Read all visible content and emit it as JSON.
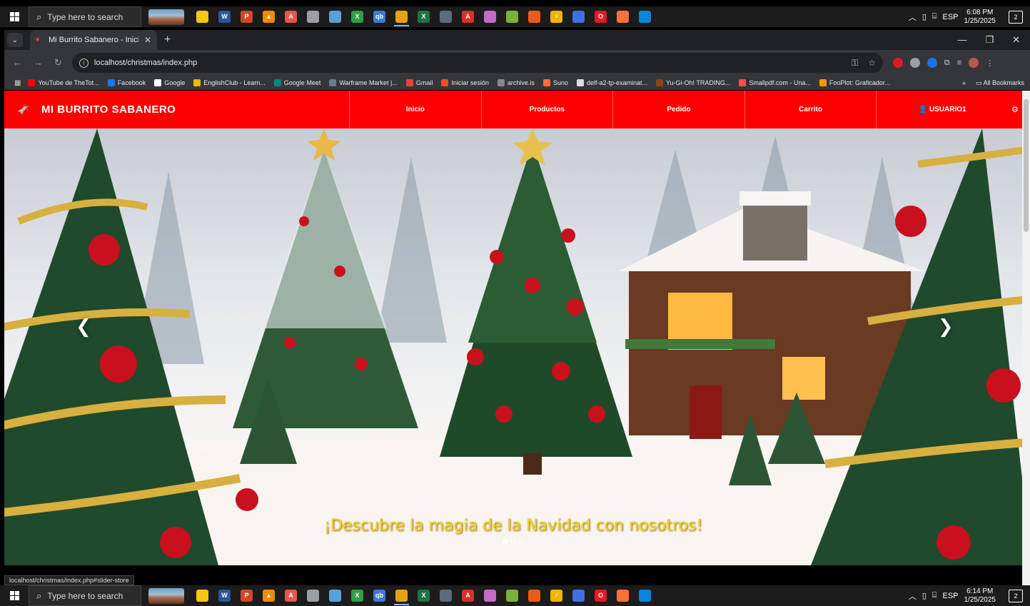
{
  "taskbar": {
    "search_placeholder": "Type here to search",
    "apps": [
      {
        "icon": "file-explorer-icon",
        "color": "#f5c518",
        "glyph": ""
      },
      {
        "icon": "word-icon",
        "color": "#2b579a",
        "glyph": "W"
      },
      {
        "icon": "powerpoint-icon",
        "color": "#d24726",
        "glyph": "P"
      },
      {
        "icon": "vlc-icon",
        "color": "#f08a00",
        "glyph": "▲"
      },
      {
        "icon": "pdf-reader-icon",
        "color": "#e2574c",
        "glyph": "A"
      },
      {
        "icon": "cloud-app-icon",
        "color": "#9aa0a6",
        "glyph": ""
      },
      {
        "icon": "feather-app-icon",
        "color": "#5aa0d8",
        "glyph": ""
      },
      {
        "icon": "xbox-icon",
        "color": "#2f9e44",
        "glyph": "X"
      },
      {
        "icon": "qbittorrent-icon",
        "color": "#3c7bd8",
        "glyph": "qb"
      },
      {
        "icon": "chrome-icon",
        "color": "#e6a117",
        "glyph": "",
        "active": true
      },
      {
        "icon": "excel-icon",
        "color": "#1f7244",
        "glyph": "X"
      },
      {
        "icon": "calculator-icon",
        "color": "#5b6b7b",
        "glyph": ""
      },
      {
        "icon": "acrobat-icon",
        "color": "#d93025",
        "glyph": "A"
      },
      {
        "icon": "paint-icon",
        "color": "#c46ac8",
        "glyph": ""
      },
      {
        "icon": "tools-icon",
        "color": "#7bb03a",
        "glyph": ""
      },
      {
        "icon": "game-icon",
        "color": "#e85d1a",
        "glyph": ""
      },
      {
        "icon": "bolt-app-icon",
        "color": "#f2b400",
        "glyph": "⚡"
      },
      {
        "icon": "monitor-app-icon",
        "color": "#4070e0",
        "glyph": ""
      },
      {
        "icon": "opera-icon",
        "color": "#e01b24",
        "glyph": "O"
      },
      {
        "icon": "firefox-icon",
        "color": "#ff7139",
        "glyph": ""
      },
      {
        "icon": "store-icon",
        "color": "#0a84d8",
        "glyph": ""
      }
    ],
    "tray_lang": "ESP",
    "top_time": "6:08 PM",
    "bottom_time": "6:14 PM",
    "date": "1/25/2025",
    "notif_count": "2"
  },
  "browser": {
    "tab_title": "Mi Burrito Sabanero - Inicio",
    "url": "localhost/christmas/index.php",
    "bookmarks": [
      {
        "label": "YouTube de TheTot...",
        "color": "#ff0000"
      },
      {
        "label": "Facebook",
        "color": "#1877f2"
      },
      {
        "label": "Google",
        "color": "#ffffff"
      },
      {
        "label": "EnglishClub - Learn...",
        "color": "#f4b400"
      },
      {
        "label": "Google Meet",
        "color": "#00897b"
      },
      {
        "label": "Warframe Market |...",
        "color": "#6c7a89"
      },
      {
        "label": "Gmail",
        "color": "#ea4335"
      },
      {
        "label": "Iniciar sesión",
        "color": "#f25022"
      },
      {
        "label": "archive.is",
        "color": "#888888"
      },
      {
        "label": "Suno",
        "color": "#ff6b35"
      },
      {
        "label": "delf-a2-tp-examinat...",
        "color": "#dddddd"
      },
      {
        "label": "Yu-Gi-Oh! TRADING...",
        "color": "#8b4513"
      },
      {
        "label": "Smallpdf.com - Una...",
        "color": "#ff4f4f"
      },
      {
        "label": "FooPlot: Graficador...",
        "color": "#ff9800"
      }
    ],
    "all_bookmarks": "All Bookmarks",
    "status_url": "localhost/christmas/index.php#slider-store"
  },
  "site": {
    "brand": "MI BURRITO SABANERO",
    "nav": [
      "Inicio",
      "Productos",
      "Pedido",
      "Carrito"
    ],
    "user": "USUARIO1",
    "slider_caption": "¡Descubre la magia de la Navidad con nosotros!",
    "slides_total": 3,
    "slide_active": 1
  }
}
